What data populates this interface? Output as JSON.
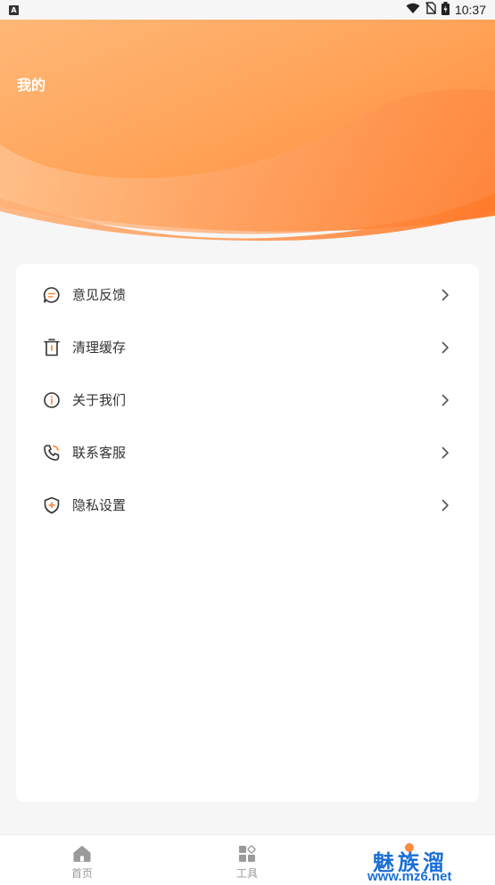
{
  "status_bar": {
    "left_glyph": "A",
    "time": "10:37",
    "icons": [
      "wifi-icon",
      "no-sim-icon",
      "battery-charging-icon"
    ]
  },
  "header": {
    "title": "我的",
    "gradient_colors": [
      "#ffb26e",
      "#ff9a4e",
      "#ff7a2e"
    ]
  },
  "menu": {
    "items": [
      {
        "label": "意见反馈",
        "icon": "feedback-icon"
      },
      {
        "label": "清理缓存",
        "icon": "trash-icon"
      },
      {
        "label": "关于我们",
        "icon": "info-icon"
      },
      {
        "label": "联系客服",
        "icon": "phone-icon"
      },
      {
        "label": "隐私设置",
        "icon": "shield-icon"
      }
    ]
  },
  "tab_bar": {
    "tabs": [
      {
        "label": "首页",
        "icon": "home-icon"
      },
      {
        "label": "工具",
        "icon": "tools-icon"
      }
    ]
  },
  "watermark": {
    "title": "魅族溜",
    "url": "www.mz6.net"
  },
  "colors": {
    "accent": "#ff8a3d",
    "icon_dark": "#333333",
    "tab_inactive": "#9a9a9a"
  }
}
